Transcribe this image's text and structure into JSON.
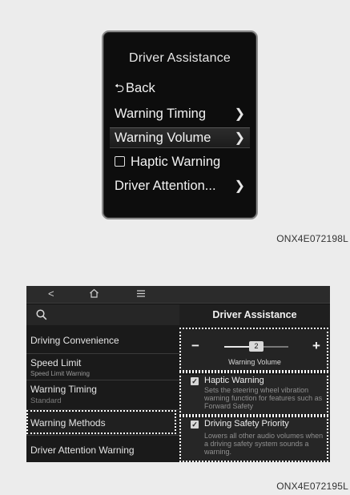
{
  "cluster": {
    "title": "Driver Assistance",
    "items": [
      {
        "label": "Back",
        "icon": "back-arrow-icon",
        "chevron": false
      },
      {
        "label": "Warning Timing",
        "chevron": true
      },
      {
        "label": "Warning Volume",
        "chevron": true,
        "selected": true
      },
      {
        "label": "Haptic Warning",
        "checkbox": true,
        "checked": false
      },
      {
        "label": "Driver Attention...",
        "chevron": true
      }
    ],
    "image_code": "ONX4E072198L"
  },
  "infotainment": {
    "topbar": {
      "back_glyph": "<",
      "home_icon": "home-icon",
      "menu_icon": "menu-icon"
    },
    "search_icon": "search-icon",
    "page_title": "Driver Assistance",
    "sidebar": [
      {
        "label": "Driving Convenience"
      },
      {
        "label": "Speed Limit",
        "sub": "Speed Limit Warning"
      },
      {
        "label": "Warning Timing",
        "sub": "Standard"
      },
      {
        "label": "Warning Methods",
        "highlighted": true
      },
      {
        "label": "Driver Attention Warning"
      }
    ],
    "volume": {
      "minus": "−",
      "plus": "+",
      "value": "2",
      "label": "Warning Volume",
      "level_fraction": 0.5
    },
    "options": [
      {
        "label": "Haptic Warning",
        "checked": true,
        "description": "Sets the steering wheel vibration warning function for features such as Forward Safety"
      },
      {
        "label": "Driving Safety Priority",
        "checked": true,
        "description": "Lowers all other audio volumes when a driving safety system sounds a warning."
      }
    ],
    "image_code": "ONX4E072195L",
    "highlight_color": "#ffffff"
  }
}
